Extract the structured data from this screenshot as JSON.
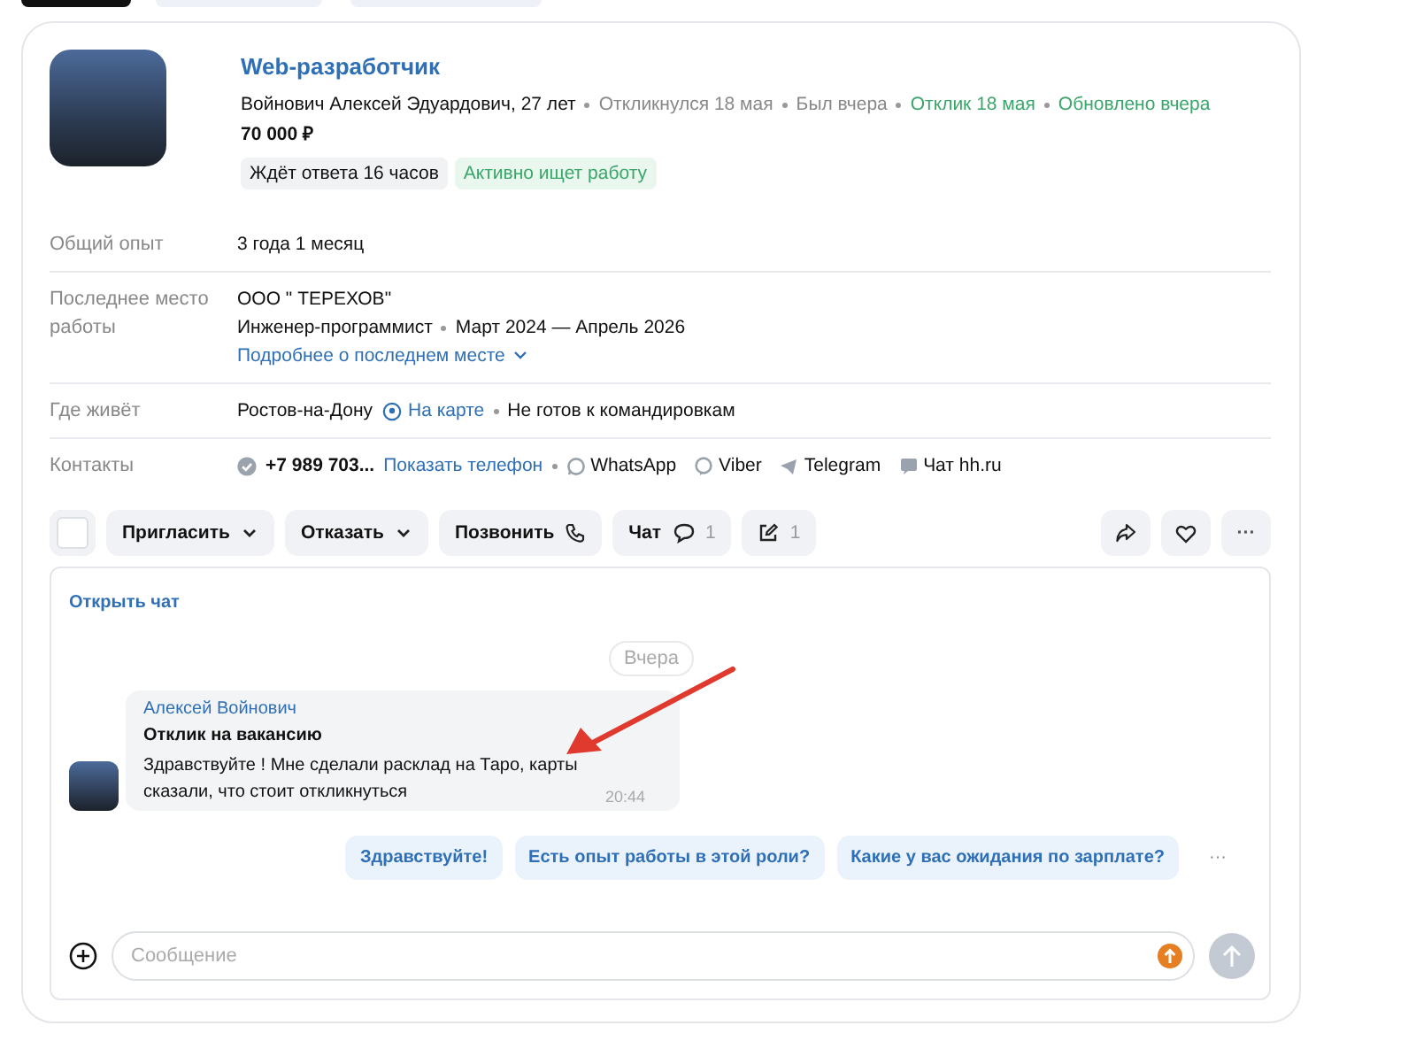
{
  "candidate": {
    "title": "Web-разработчик",
    "name_age": "Войнович Алексей Эдуардович, 27 лет",
    "meta": [
      {
        "text": "Откликнулся 18 мая",
        "color": "#888888"
      },
      {
        "text": "Был вчера",
        "color": "#888888"
      },
      {
        "text": "Отклик 18 мая",
        "color": "#3aa66a"
      },
      {
        "text": "Обновлено вчера",
        "color": "#3aa66a"
      }
    ],
    "salary": "70 000 ₽",
    "badges": [
      {
        "text": "Ждёт ответа 16 часов",
        "kind": "neutral"
      },
      {
        "text": "Активно ищет работу",
        "kind": "success"
      }
    ]
  },
  "details": [
    {
      "kind": "text",
      "label": "Общий опыт",
      "value": "3 года 1 месяц"
    },
    {
      "kind": "job",
      "label": "Последнее место работы",
      "company": "ООО \" ТЕРЕХОВ\"",
      "position": "Инженер-программист",
      "period": "Март 2024 — Апрель 2026",
      "link": "Подробнее о последнем месте"
    },
    {
      "kind": "location",
      "label": "Где живёт",
      "city": "Ростов-на-Дону",
      "map_link": "На карте",
      "travel": "Не готов к командировкам"
    },
    {
      "kind": "contacts",
      "label": "Контакты",
      "phone": "+7 989 703...",
      "show_phone": "Показать телефон",
      "channels": [
        {
          "kind": "whatsapp",
          "text": "WhatsApp"
        },
        {
          "kind": "viber",
          "text": "Viber"
        },
        {
          "kind": "telegram",
          "text": "Telegram"
        },
        {
          "kind": "chat",
          "text": "Чат hh.ru"
        }
      ]
    }
  ],
  "actions": {
    "checkbox": {
      "checked": false
    },
    "buttons": [
      {
        "kind": "dropdown",
        "label": "Пригласить"
      },
      {
        "kind": "dropdown",
        "label": "Отказать"
      },
      {
        "kind": "phone",
        "label": "Позвонить"
      },
      {
        "kind": "chat",
        "label": "Чат",
        "count": "1"
      },
      {
        "kind": "edit",
        "count": "1"
      }
    ],
    "more": "···"
  },
  "chat": {
    "open_link": "Открыть чат",
    "date_chip": "Вчера",
    "messages": [
      {
        "author": "Алексей Войнович",
        "subject": "Отклик на вакансию",
        "text": "Здравствуйте ! Мне сделали расклад на Таро, карты сказали, что стоит откликнуться",
        "time": "20:44"
      }
    ],
    "quick_replies": [
      "Здравствуйте!",
      "Есть опыт работы в этой роли?",
      "Какие у вас ожидания по зарплате?"
    ],
    "more": "···",
    "input": {
      "placeholder": "Сообщение"
    }
  }
}
